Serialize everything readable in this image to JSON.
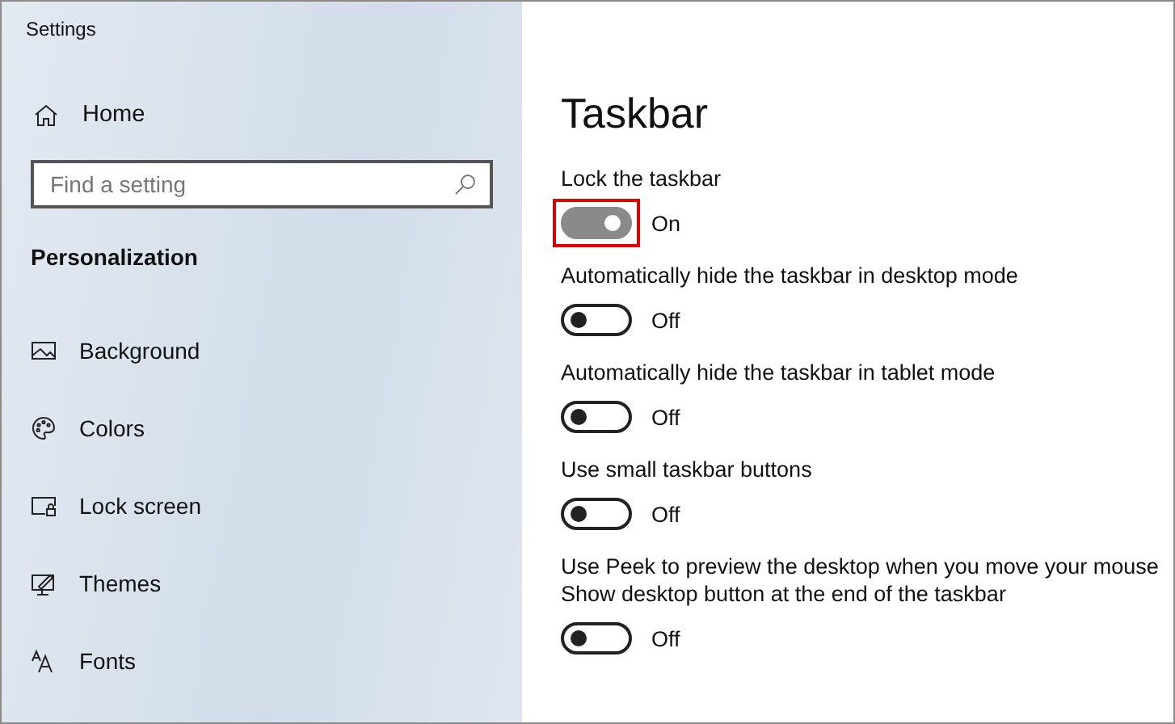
{
  "window": {
    "title": "Settings"
  },
  "sidebar": {
    "home": "Home",
    "search": {
      "placeholder": "Find a setting"
    },
    "section": "Personalization",
    "items": [
      {
        "label": "Background"
      },
      {
        "label": "Colors"
      },
      {
        "label": "Lock screen"
      },
      {
        "label": "Themes"
      },
      {
        "label": "Fonts"
      }
    ]
  },
  "page": {
    "title": "Taskbar",
    "settings": [
      {
        "lines": [
          "Lock the taskbar"
        ],
        "on": true,
        "disabled": true,
        "highlighted": true,
        "state": "On"
      },
      {
        "lines": [
          "Automatically hide the taskbar in desktop mode"
        ],
        "on": false,
        "disabled": false,
        "highlighted": false,
        "state": "Off"
      },
      {
        "lines": [
          "Automatically hide the taskbar in tablet mode"
        ],
        "on": false,
        "disabled": false,
        "highlighted": false,
        "state": "Off"
      },
      {
        "lines": [
          "Use small taskbar buttons"
        ],
        "on": false,
        "disabled": false,
        "highlighted": false,
        "state": "Off"
      },
      {
        "lines": [
          "Use Peek to preview the desktop when you move your mouse",
          "Show desktop button at the end of the taskbar"
        ],
        "on": false,
        "disabled": false,
        "highlighted": false,
        "state": "Off"
      }
    ]
  }
}
